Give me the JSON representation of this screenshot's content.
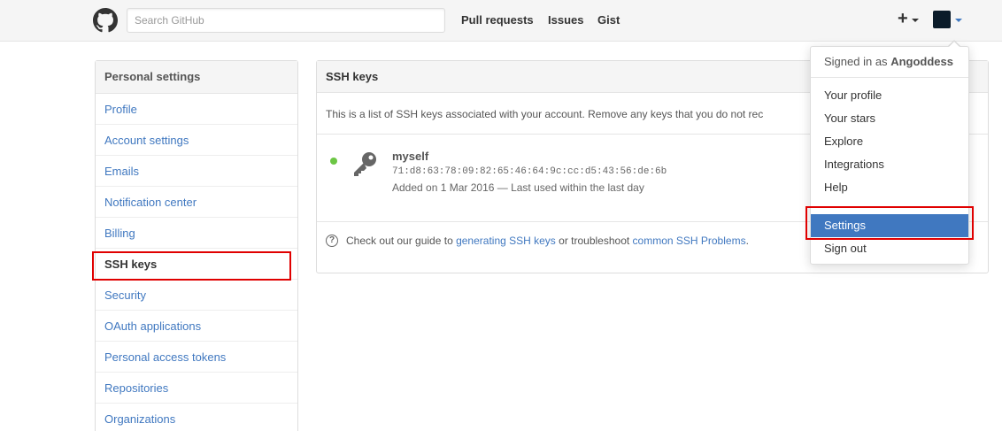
{
  "header": {
    "logo_icon": "github-mark-icon",
    "search_placeholder": "Search GitHub",
    "nav": [
      "Pull requests",
      "Issues",
      "Gist"
    ],
    "plus_label": "+",
    "plus_icon": "plus-icon",
    "avatar_icon": "user-avatar"
  },
  "sidebar": {
    "title": "Personal settings",
    "items": [
      {
        "label": "Profile"
      },
      {
        "label": "Account settings"
      },
      {
        "label": "Emails"
      },
      {
        "label": "Notification center"
      },
      {
        "label": "Billing"
      },
      {
        "label": "SSH keys"
      },
      {
        "label": "Security"
      },
      {
        "label": "OAuth applications"
      },
      {
        "label": "Personal access tokens"
      },
      {
        "label": "Repositories"
      },
      {
        "label": "Organizations"
      }
    ]
  },
  "main": {
    "title": "SSH keys",
    "description": "This is a list of SSH keys associated with your account. Remove any keys that you do not rec",
    "key": {
      "name": "myself",
      "fingerprint": "71:d8:63:78:09:82:65:46:64:9c:cc:d5:43:56:de:6b",
      "added": "Added on 1 Mar 2016 — Last used within the last day",
      "status_color": "#6cc644"
    },
    "help": {
      "prefix": "Check out our guide to ",
      "link1": "generating SSH keys",
      "middle": " or troubleshoot ",
      "link2": "common SSH Problems",
      "suffix": "."
    }
  },
  "dropdown": {
    "signed_in_prefix": "Signed in as",
    "username": "Angoddess",
    "items": [
      "Your profile",
      "Your stars",
      "Explore",
      "Integrations",
      "Help",
      "Settings",
      "Sign out"
    ]
  },
  "colors": {
    "link": "#4078c0",
    "active_bg": "#4078c0",
    "highlight": "#e00000"
  }
}
